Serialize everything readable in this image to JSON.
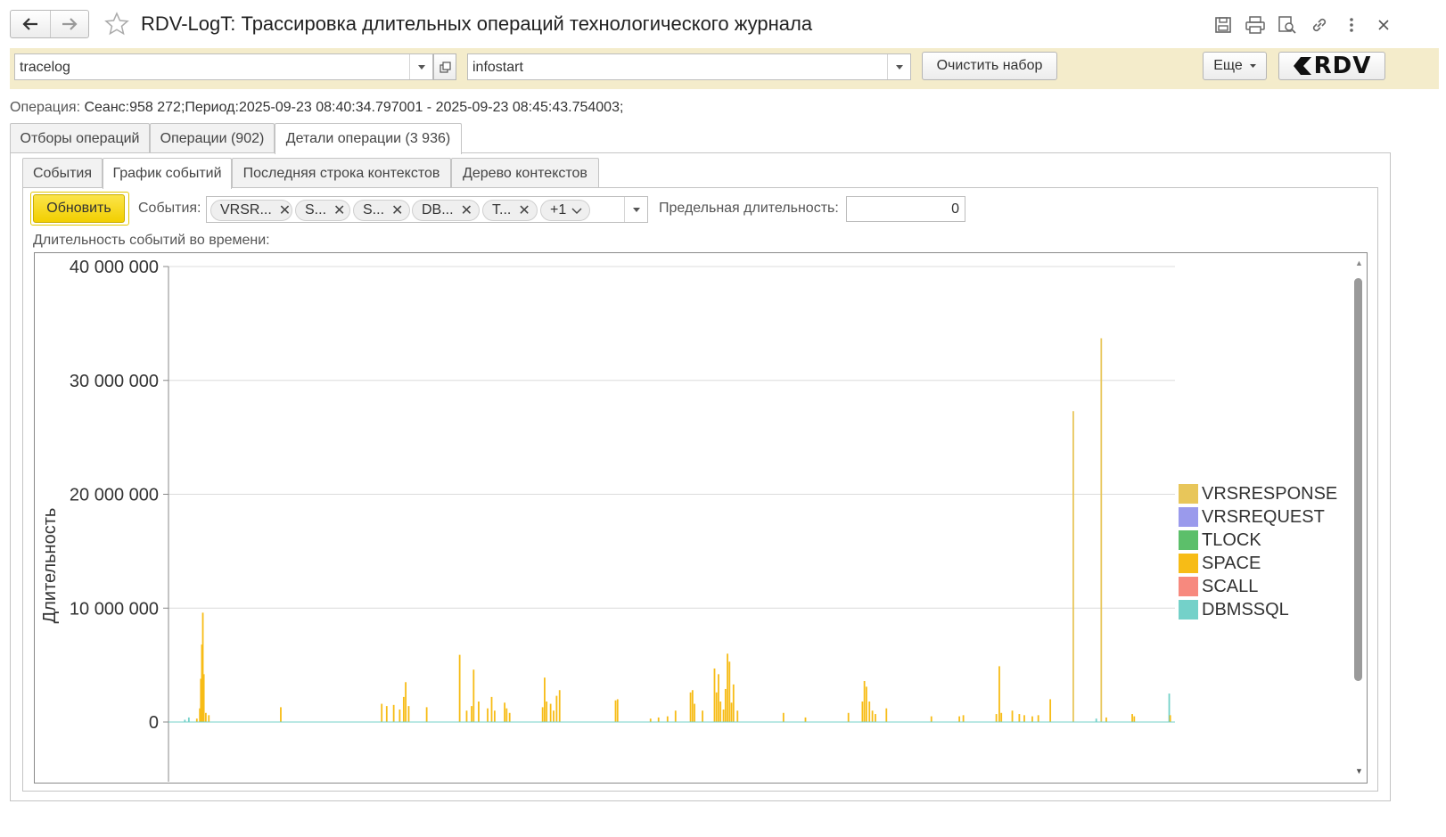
{
  "window": {
    "title": "RDV-LogT: Трассировка длительных операций технологического журнала"
  },
  "toolbar": {
    "source_field_value": "tracelog",
    "database_field_value": "infostart",
    "clear_set_label": "Очистить набор",
    "more_label": "Еще",
    "logo_text": "RDV"
  },
  "operation": {
    "label": "Операция:",
    "value": "Сеанс:958 272;Период:2025-09-23 08:40:34.797001 - 2025-09-23 08:45:43.754003;"
  },
  "main_tabs": [
    {
      "label": "Отборы операций"
    },
    {
      "label": "Операции (902)"
    },
    {
      "label": "Детали операции (3 936)"
    }
  ],
  "sub_tabs": [
    {
      "label": "События"
    },
    {
      "label": "График событий"
    },
    {
      "label": "Последняя строка контекстов"
    },
    {
      "label": "Дерево контекстов"
    }
  ],
  "controls": {
    "refresh_label": "Обновить",
    "events_label": "События:",
    "event_chips": [
      {
        "label": "VRSR..."
      },
      {
        "label": "S..."
      },
      {
        "label": "S..."
      },
      {
        "label": "DB..."
      },
      {
        "label": "T..."
      }
    ],
    "more_chip_label": "+1",
    "max_duration_label": "Предельная длительность:",
    "max_duration_value": "0"
  },
  "chart_caption": "Длительность событий во времени:",
  "chart_data": {
    "type": "bar",
    "title": "",
    "xlabel": "",
    "ylabel": "Длительность",
    "ylim": [
      0,
      40000000
    ],
    "y_ticks": [
      "40 000 000",
      "30 000 000",
      "20 000 000",
      "10 000 000",
      "0"
    ],
    "grid": true,
    "legend_position": "right",
    "series": [
      {
        "name": "VRSRESPONSE",
        "color": "#e8c65a"
      },
      {
        "name": "VRSREQUEST",
        "color": "#9a9aec"
      },
      {
        "name": "TLOCK",
        "color": "#5cbf6a"
      },
      {
        "name": "SPACE",
        "color": "#f7bc16"
      },
      {
        "name": "SCALL",
        "color": "#f7897e"
      },
      {
        "name": "DBMSSQL",
        "color": "#74d1c9"
      }
    ],
    "points": [
      {
        "x": 0.012,
        "y": 200000,
        "series": "DBMSSQL"
      },
      {
        "x": 0.016,
        "y": 400000,
        "series": "DBMSSQL"
      },
      {
        "x": 0.024,
        "y": 300000,
        "series": "SPACE"
      },
      {
        "x": 0.027,
        "y": 1200000,
        "series": "SPACE"
      },
      {
        "x": 0.028,
        "y": 3800000,
        "series": "SPACE"
      },
      {
        "x": 0.029,
        "y": 6800000,
        "series": "SPACE"
      },
      {
        "x": 0.03,
        "y": 9600000,
        "series": "SPACE"
      },
      {
        "x": 0.031,
        "y": 4200000,
        "series": "SPACE"
      },
      {
        "x": 0.033,
        "y": 800000,
        "series": "SPACE"
      },
      {
        "x": 0.036,
        "y": 600000,
        "series": "SPACE"
      },
      {
        "x": 0.108,
        "y": 1300000,
        "series": "SPACE"
      },
      {
        "x": 0.209,
        "y": 1600000,
        "series": "SPACE"
      },
      {
        "x": 0.214,
        "y": 1400000,
        "series": "SPACE"
      },
      {
        "x": 0.221,
        "y": 1500000,
        "series": "SPACE"
      },
      {
        "x": 0.227,
        "y": 1100000,
        "series": "SPACE"
      },
      {
        "x": 0.231,
        "y": 2200000,
        "series": "SPACE"
      },
      {
        "x": 0.233,
        "y": 3500000,
        "series": "SPACE"
      },
      {
        "x": 0.236,
        "y": 1400000,
        "series": "SPACE"
      },
      {
        "x": 0.254,
        "y": 1300000,
        "series": "SPACE"
      },
      {
        "x": 0.287,
        "y": 5900000,
        "series": "SPACE"
      },
      {
        "x": 0.294,
        "y": 1000000,
        "series": "SPACE"
      },
      {
        "x": 0.299,
        "y": 1400000,
        "series": "SPACE"
      },
      {
        "x": 0.301,
        "y": 4600000,
        "series": "SPACE"
      },
      {
        "x": 0.306,
        "y": 1800000,
        "series": "SPACE"
      },
      {
        "x": 0.315,
        "y": 1200000,
        "series": "SPACE"
      },
      {
        "x": 0.319,
        "y": 2200000,
        "series": "SPACE"
      },
      {
        "x": 0.322,
        "y": 1000000,
        "series": "SPACE"
      },
      {
        "x": 0.332,
        "y": 1700000,
        "series": "SPACE"
      },
      {
        "x": 0.334,
        "y": 1200000,
        "series": "SPACE"
      },
      {
        "x": 0.337,
        "y": 800000,
        "series": "SPACE"
      },
      {
        "x": 0.37,
        "y": 1300000,
        "series": "SPACE"
      },
      {
        "x": 0.372,
        "y": 3900000,
        "series": "SPACE"
      },
      {
        "x": 0.374,
        "y": 1800000,
        "series": "SPACE"
      },
      {
        "x": 0.378,
        "y": 1600000,
        "series": "SPACE"
      },
      {
        "x": 0.381,
        "y": 1000000,
        "series": "SPACE"
      },
      {
        "x": 0.384,
        "y": 2300000,
        "series": "SPACE"
      },
      {
        "x": 0.387,
        "y": 2800000,
        "series": "SPACE"
      },
      {
        "x": 0.443,
        "y": 1900000,
        "series": "SPACE"
      },
      {
        "x": 0.445,
        "y": 2000000,
        "series": "SPACE"
      },
      {
        "x": 0.478,
        "y": 300000,
        "series": "SPACE"
      },
      {
        "x": 0.486,
        "y": 400000,
        "series": "SPACE"
      },
      {
        "x": 0.495,
        "y": 500000,
        "series": "SPACE"
      },
      {
        "x": 0.503,
        "y": 1000000,
        "series": "SPACE"
      },
      {
        "x": 0.518,
        "y": 2600000,
        "series": "SPACE"
      },
      {
        "x": 0.52,
        "y": 2800000,
        "series": "SPACE"
      },
      {
        "x": 0.522,
        "y": 1600000,
        "series": "SPACE"
      },
      {
        "x": 0.53,
        "y": 1000000,
        "series": "SPACE"
      },
      {
        "x": 0.542,
        "y": 4700000,
        "series": "SPACE"
      },
      {
        "x": 0.544,
        "y": 2600000,
        "series": "SPACE"
      },
      {
        "x": 0.546,
        "y": 4200000,
        "series": "SPACE"
      },
      {
        "x": 0.548,
        "y": 1800000,
        "series": "SPACE"
      },
      {
        "x": 0.551,
        "y": 1100000,
        "series": "SPACE"
      },
      {
        "x": 0.553,
        "y": 2900000,
        "series": "SPACE"
      },
      {
        "x": 0.555,
        "y": 6000000,
        "series": "SPACE"
      },
      {
        "x": 0.557,
        "y": 5300000,
        "series": "SPACE"
      },
      {
        "x": 0.559,
        "y": 1700000,
        "series": "SPACE"
      },
      {
        "x": 0.561,
        "y": 3300000,
        "series": "SPACE"
      },
      {
        "x": 0.565,
        "y": 1000000,
        "series": "SPACE"
      },
      {
        "x": 0.611,
        "y": 800000,
        "series": "SPACE"
      },
      {
        "x": 0.633,
        "y": 400000,
        "series": "SPACE"
      },
      {
        "x": 0.676,
        "y": 800000,
        "series": "SPACE"
      },
      {
        "x": 0.69,
        "y": 1800000,
        "series": "SPACE"
      },
      {
        "x": 0.692,
        "y": 3600000,
        "series": "SPACE"
      },
      {
        "x": 0.694,
        "y": 3100000,
        "series": "SPACE"
      },
      {
        "x": 0.697,
        "y": 1800000,
        "series": "SPACE"
      },
      {
        "x": 0.7,
        "y": 1000000,
        "series": "SPACE"
      },
      {
        "x": 0.703,
        "y": 700000,
        "series": "SPACE"
      },
      {
        "x": 0.714,
        "y": 1200000,
        "series": "SPACE"
      },
      {
        "x": 0.759,
        "y": 500000,
        "series": "SPACE"
      },
      {
        "x": 0.787,
        "y": 500000,
        "series": "SPACE"
      },
      {
        "x": 0.791,
        "y": 600000,
        "series": "SPACE"
      },
      {
        "x": 0.824,
        "y": 700000,
        "series": "SPACE"
      },
      {
        "x": 0.827,
        "y": 4900000,
        "series": "SPACE"
      },
      {
        "x": 0.829,
        "y": 800000,
        "series": "SPACE"
      },
      {
        "x": 0.84,
        "y": 1000000,
        "series": "SPACE"
      },
      {
        "x": 0.847,
        "y": 700000,
        "series": "SPACE"
      },
      {
        "x": 0.852,
        "y": 600000,
        "series": "SPACE"
      },
      {
        "x": 0.86,
        "y": 500000,
        "series": "SPACE"
      },
      {
        "x": 0.866,
        "y": 600000,
        "series": "SPACE"
      },
      {
        "x": 0.878,
        "y": 2000000,
        "series": "SPACE"
      },
      {
        "x": 0.901,
        "y": 27300000,
        "series": "VRSRESPONSE"
      },
      {
        "x": 0.924,
        "y": 300000,
        "series": "DBMSSQL"
      },
      {
        "x": 0.929,
        "y": 33700000,
        "series": "VRSRESPONSE"
      },
      {
        "x": 0.934,
        "y": 400000,
        "series": "SPACE"
      },
      {
        "x": 0.96,
        "y": 700000,
        "series": "SPACE"
      },
      {
        "x": 0.962,
        "y": 500000,
        "series": "SPACE"
      },
      {
        "x": 0.997,
        "y": 2500000,
        "series": "DBMSSQL"
      },
      {
        "x": 0.998,
        "y": 600000,
        "series": "SPACE"
      }
    ]
  }
}
